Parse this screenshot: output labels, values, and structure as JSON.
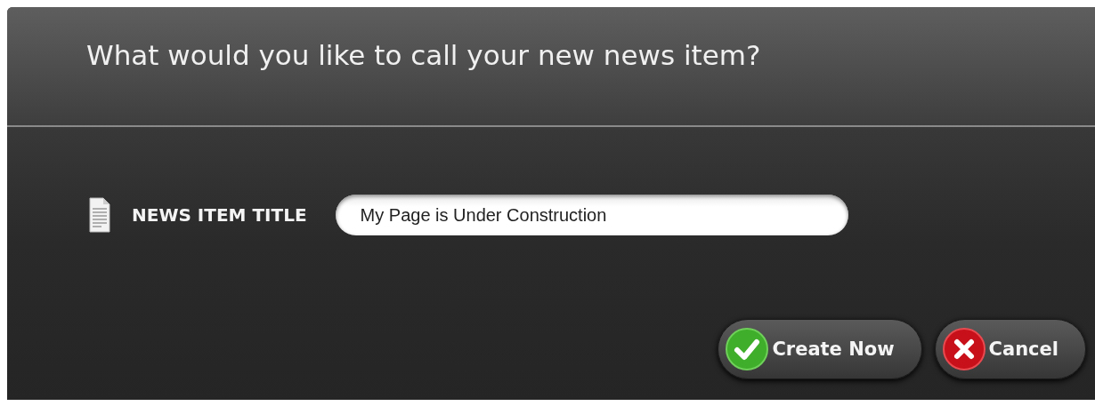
{
  "dialog": {
    "title": "What would you like to call your new news item?"
  },
  "field": {
    "label": "NEWS ITEM TITLE",
    "value": "My Page is Under Construction"
  },
  "buttons": [
    {
      "kind": "confirm",
      "label": "Create Now"
    },
    {
      "kind": "cancel",
      "label": "Cancel"
    }
  ]
}
